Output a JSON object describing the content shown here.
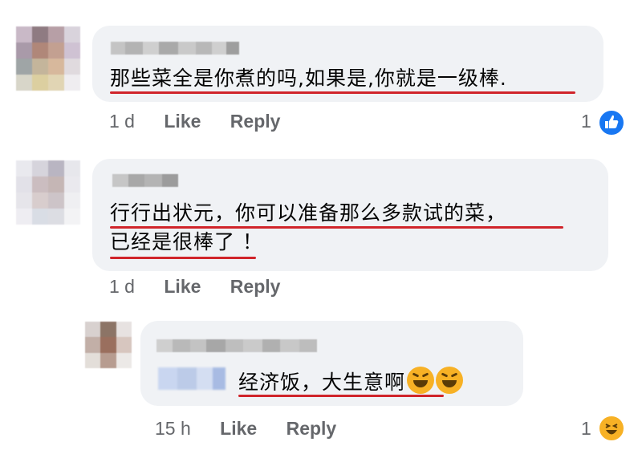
{
  "comments": [
    {
      "text_lines": [
        "那些菜全是你煮的吗,如果是,你就是一级棒."
      ],
      "time": "1 d",
      "like_label": "Like",
      "reply_label": "Reply",
      "reaction_count": "1",
      "reaction_icon": "thumbs-up-icon"
    },
    {
      "text_lines": [
        "行行出状元，你可以准备那么多款试的菜，",
        "已经是很棒了 ！"
      ],
      "time": "1 d",
      "like_label": "Like",
      "reply_label": "Reply",
      "reaction_count": "",
      "reaction_icon": ""
    }
  ],
  "reply": {
    "text": "经济饭，大生意啊",
    "trailing_emoji": [
      "rolling-laughing-icon",
      "rolling-laughing-icon"
    ],
    "time": "15 h",
    "like_label": "Like",
    "reply_label": "Reply",
    "reaction_count": "1",
    "reaction_icon": "haha-face-icon"
  },
  "colors": {
    "bubble": "#f0f2f5",
    "underline": "#d0242a",
    "meta_text": "#65676b",
    "like_blue": "#1877f2",
    "haha_yellow": "#f7b125"
  }
}
